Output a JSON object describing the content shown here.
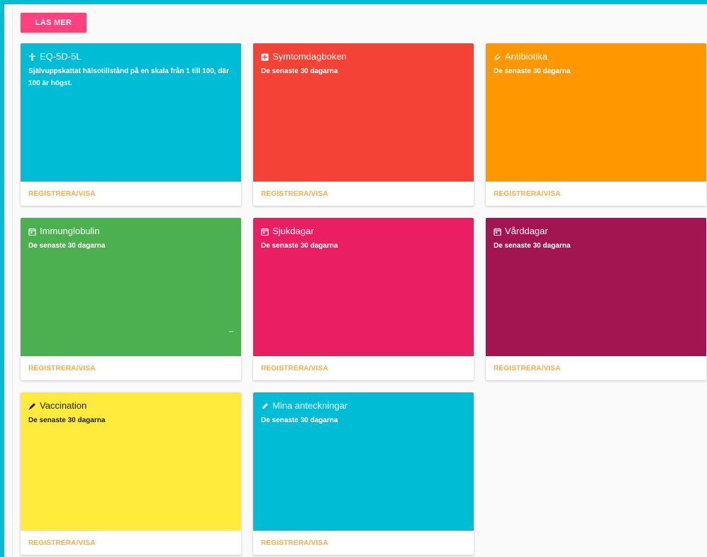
{
  "header": {
    "more_button_label": "LÄS MER"
  },
  "action_label": "REGISTRERA/VISA",
  "colors": {
    "frame": "#00bcd4",
    "button": "#ff4081",
    "action": "#ffab40"
  },
  "cards": [
    {
      "title": "EQ-5D-5L",
      "subtitle": "Självuppskattat hälsotillstånd på en skala från 1 till 100, där 100 är högst.",
      "icon": "person-icon",
      "color": "#00bcd4"
    },
    {
      "title": "Symtomdagboken",
      "subtitle": "De senaste 30 dagarna",
      "icon": "plus-box-icon",
      "color": "#f44336"
    },
    {
      "title": "Antibiotika",
      "subtitle": "De senaste 30 dagarna",
      "icon": "pill-icon",
      "color": "#ff9800"
    },
    {
      "title": "Immunglobulin",
      "subtitle": "De senaste 30 dagarna",
      "icon": "calendar-icon",
      "color": "#4caf50"
    },
    {
      "title": "Sjukdagar",
      "subtitle": "De senaste 30 dagarna",
      "icon": "calendar-icon",
      "color": "#e91e63"
    },
    {
      "title": "Vårddagar",
      "subtitle": "De senaste 30 dagarna",
      "icon": "calendar-icon",
      "color": "#a31551"
    },
    {
      "title": "Vaccination",
      "subtitle": "De senaste 30 dagarna",
      "icon": "syringe-icon",
      "color": "#ffeb3b"
    },
    {
      "title": "Mina anteckningar",
      "subtitle": "De senaste 30 dagarna",
      "icon": "pencil-icon",
      "color": "#00bcd4"
    }
  ]
}
